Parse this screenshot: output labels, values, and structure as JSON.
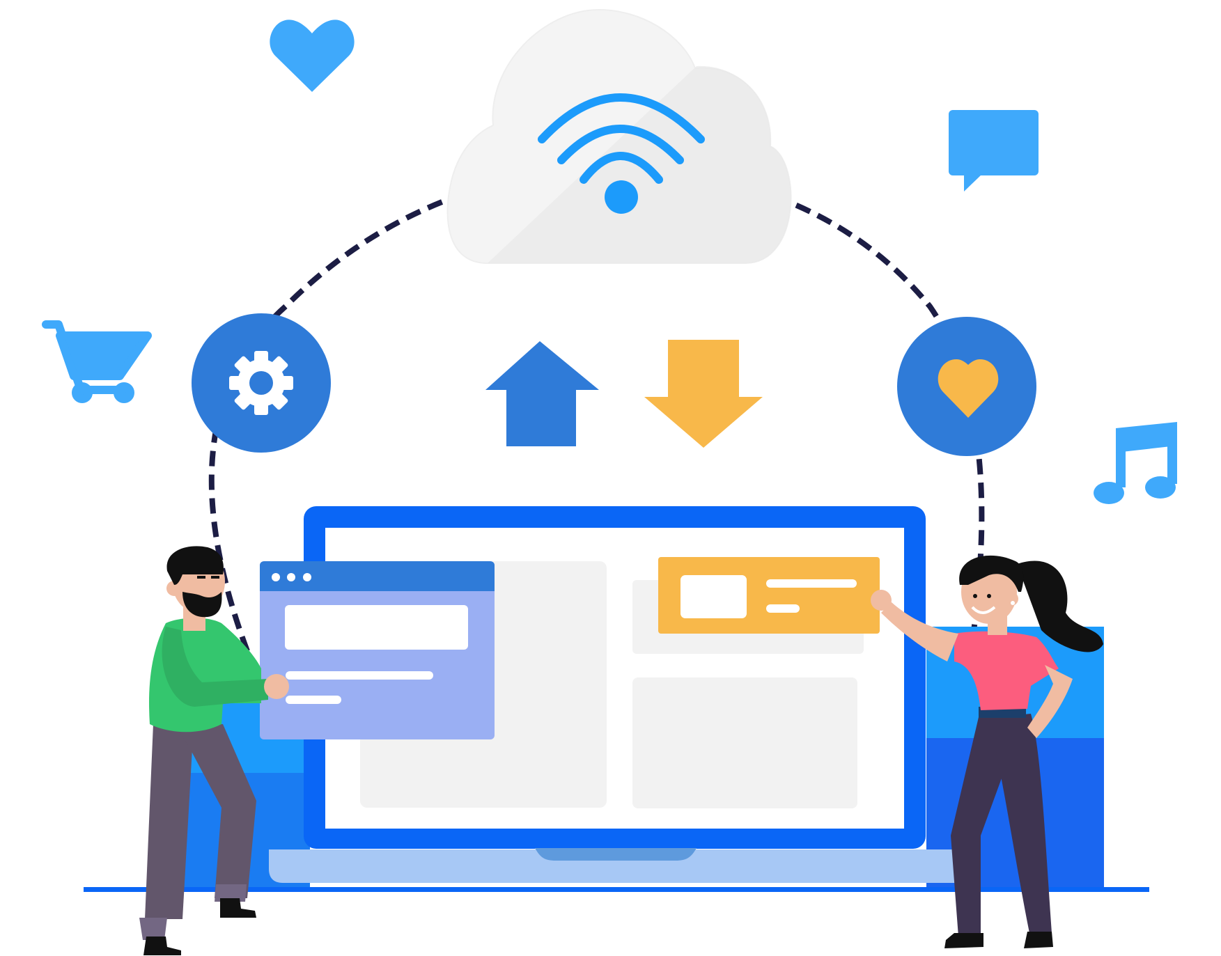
{
  "illustration": {
    "subject": "cloud-connectivity",
    "icons": [
      "heart-icon",
      "chat-bubble-icon",
      "shopping-cart-icon",
      "music-note-icon",
      "gear-icon",
      "heart-badge-icon",
      "wifi-icon",
      "cloud-icon",
      "upload-arrow-icon",
      "download-arrow-icon",
      "laptop-icon",
      "browser-window-card",
      "notification-card",
      "man-figure",
      "woman-figure"
    ]
  },
  "colors": {
    "accent_blue": "#2f7bd8",
    "light_blue": "#3fa9fb",
    "bright_blue": "#0a66f6",
    "dark_blue": "#1262ee",
    "orange": "#f8b84a",
    "lavender": "#9aaff3",
    "cloud": "#f4f4f4",
    "green_shirt": "#34c66e",
    "pink_shirt": "#fc5d7e",
    "pants_purple": "#62566b",
    "pants_dark": "#3e3451"
  }
}
